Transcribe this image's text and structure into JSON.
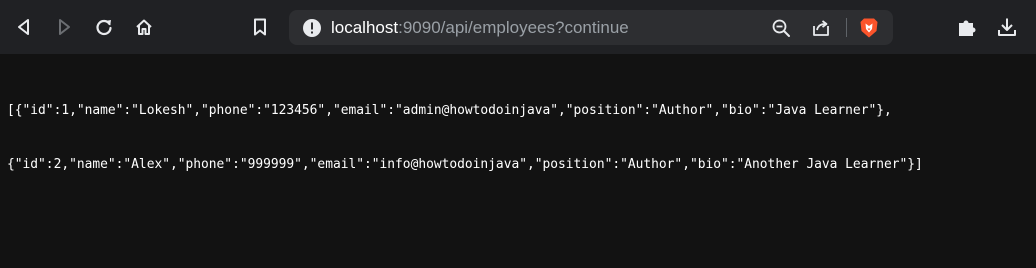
{
  "browser": {
    "back_icon": "back-arrow-icon",
    "forward_icon": "forward-arrow-icon",
    "reload_icon": "reload-icon",
    "home_icon": "home-icon",
    "bookmark_icon": "bookmark-icon",
    "site_info_icon": "info-circle-icon",
    "zoom_icon": "zoom-out-icon",
    "share_icon": "share-icon",
    "brave_shields_icon": "brave-lion-icon",
    "extensions_icon": "puzzle-piece-icon",
    "downloads_icon": "download-icon",
    "url_host": "localhost",
    "url_rest": ":9090/api/employees?continue"
  },
  "response": {
    "line1": "[{\"id\":1,\"name\":\"Lokesh\",\"phone\":\"123456\",\"email\":\"admin@howtodoinjava\",\"position\":\"Author\",\"bio\":\"Java Learner\"},",
    "line2": "{\"id\":2,\"name\":\"Alex\",\"phone\":\"999999\",\"email\":\"info@howtodoinjava\",\"position\":\"Author\",\"bio\":\"Another Java Learner\"}]"
  },
  "colors": {
    "toolbar_bg": "#202124",
    "omnibox_bg": "#2d2e31",
    "page_bg": "#121212",
    "brave_orange": "#fb542b"
  }
}
